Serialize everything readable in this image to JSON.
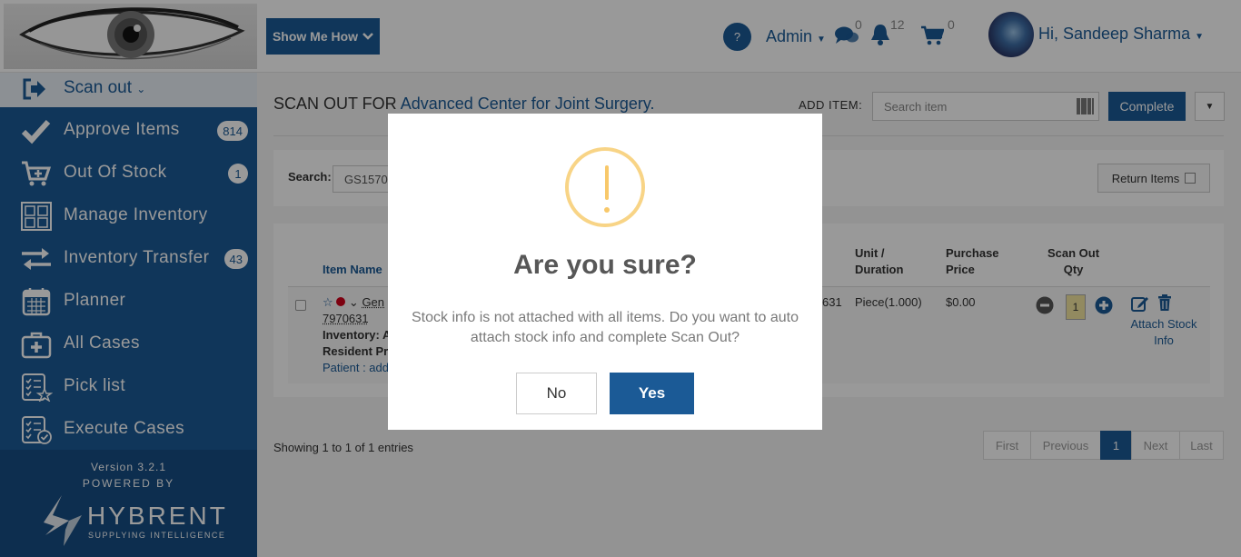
{
  "header": {
    "show_me_how": "Show Me How",
    "help": "?",
    "admin": "Admin",
    "messages_count": "0",
    "notifications_count": "12",
    "cart_count": "0",
    "user_greeting": "Hi, Sandeep Sharma"
  },
  "sidebar": {
    "current": "Scan out",
    "items": [
      {
        "label": "Approve Items",
        "badge": "814",
        "icon": "checkmark-icon"
      },
      {
        "label": "Out Of Stock",
        "badge": "1",
        "icon": "cart-plus-icon"
      },
      {
        "label": "Manage Inventory",
        "badge": "",
        "icon": "inventory-grid-icon"
      },
      {
        "label": "Inventory Transfer",
        "badge": "43",
        "icon": "transfer-arrows-icon"
      },
      {
        "label": "Planner",
        "badge": "",
        "icon": "calendar-icon"
      },
      {
        "label": "All Cases",
        "badge": "",
        "icon": "medical-case-icon"
      },
      {
        "label": "Pick list",
        "badge": "",
        "icon": "checklist-star-icon"
      },
      {
        "label": "Execute Cases",
        "badge": "",
        "icon": "checklist-check-icon"
      }
    ],
    "version": "Version 3.2.1",
    "powered_by": "POWERED BY",
    "brand": "HYBRENT",
    "brand_tagline": "SUPPLYING INTELLIGENCE"
  },
  "main": {
    "title_prefix": "SCAN OUT FOR",
    "hospital": "Advanced Center for Joint Surgery.",
    "add_item_label": "ADD ITEM:",
    "search_item_placeholder": "Search item",
    "complete": "Complete",
    "search_label": "Search:",
    "search_value": "GS1570",
    "return_items": "Return Items",
    "table": {
      "headers": {
        "item_name": "Item Name",
        "unit_line1": "Unit /",
        "unit_line2": "Duration",
        "price_line1": "Purchase",
        "price_line2": "Price",
        "qty_line1": "Scan Out",
        "qty_line2": "Qty"
      },
      "row": {
        "name_partial": "Gen",
        "code": "7970631",
        "inventory": "Inventory: A",
        "resident": "Resident Pr",
        "patient": "Patient : add",
        "id_partial": "631",
        "unit": "Piece(1.000)",
        "price": "$0.00",
        "qty": "1",
        "attach_line1": "Attach Stock",
        "attach_line2": "Info"
      }
    },
    "showing": "Showing 1 to 1 of 1 entries",
    "pager": [
      "First",
      "Previous",
      "1",
      "Next",
      "Last"
    ]
  },
  "modal": {
    "title": "Are you sure?",
    "text": "Stock info is not attached with all items. Do you want to auto attach stock info and complete Scan Out?",
    "no": "No",
    "yes": "Yes"
  }
}
